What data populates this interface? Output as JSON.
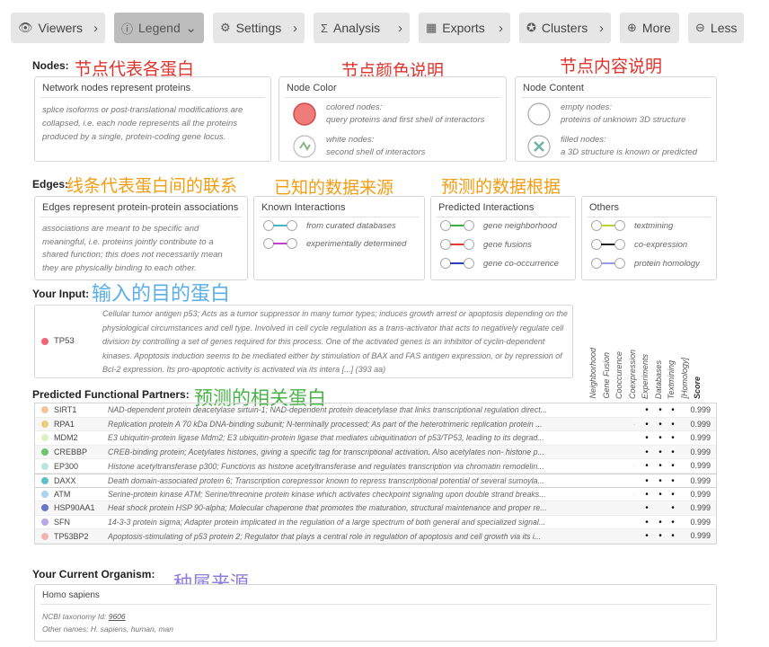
{
  "toolbar": {
    "buttons": [
      {
        "icon": "eye-icon",
        "glyph": "👁",
        "label": "Viewers",
        "chevron": "›"
      },
      {
        "icon": "info-icon",
        "glyph": "ⓘ",
        "label": "Legend",
        "chevron": "⌄"
      },
      {
        "icon": "gear-icon",
        "glyph": "⚙",
        "label": "Settings",
        "chevron": "›"
      },
      {
        "icon": "sigma-icon",
        "glyph": "Σ",
        "label": "Analysis",
        "chevron": "›"
      },
      {
        "icon": "table-icon",
        "glyph": "▦",
        "label": "Exports",
        "chevron": "›"
      },
      {
        "icon": "clusters-icon",
        "glyph": "✪",
        "label": "Clusters",
        "chevron": "›"
      },
      {
        "icon": "plus-circle-icon",
        "glyph": "⊕",
        "label": "More",
        "chevron": ""
      },
      {
        "icon": "minus-circle-icon",
        "glyph": "⊖",
        "label": "Less",
        "chevron": ""
      }
    ]
  },
  "nodes": {
    "label": "Nodes:",
    "annot_left": "节点代表各蛋白",
    "annot_mid": "节点颜色说明",
    "annot_right": "节点内容说明",
    "box1": {
      "title": "Network nodes represent proteins",
      "text": "splice isoforms or post-translational modifications are collapsed, i.e. each node represents all the proteins produced by a single, protein-coding gene locus."
    },
    "color_box": {
      "title": "Node Color",
      "colored": "colored nodes:\nquery proteins and first shell of interactors",
      "white": "white nodes:\nsecond shell of interactors"
    },
    "content_box": {
      "title": "Node Content",
      "empty": "empty nodes:\nproteins of unknown 3D structure",
      "filled": "filled nodes:\na 3D structure is known or predicted"
    }
  },
  "edges": {
    "label": "Edges:",
    "annot_left": "线条代表蛋白间的联系",
    "annot_mid": "已知的数据来源",
    "annot_right": "预测的数据根据",
    "box1": {
      "title": "Edges represent protein-protein associations",
      "text": "associations are meant to be specific and meaningful, i.e. proteins jointly contribute to a shared function; this does not necessarily mean they are physically binding to each other."
    },
    "known": {
      "title": "Known Interactions",
      "items": [
        {
          "label": "from curated databases",
          "color": "#3fb8c8"
        },
        {
          "label": "experimentally determined",
          "color": "#c040c8"
        }
      ]
    },
    "predicted": {
      "title": "Predicted Interactions",
      "items": [
        {
          "label": "gene neighborhood",
          "color": "#3cb043"
        },
        {
          "label": "gene fusions",
          "color": "#e23a2e"
        },
        {
          "label": "gene co-occurrence",
          "color": "#2f3dbf"
        }
      ]
    },
    "others": {
      "title": "Others",
      "items": [
        {
          "label": "textmining",
          "color": "#b5d334"
        },
        {
          "label": "co-expression",
          "color": "#222222"
        },
        {
          "label": "protein homology",
          "color": "#9a9ae8"
        }
      ]
    }
  },
  "input": {
    "label": "Your Input:",
    "annot": "输入的目的蛋白",
    "protein": "TP53",
    "dot_color": "#ee6677",
    "description": "Cellular tumor antigen p53; Acts as a tumor suppressor in many tumor types; induces growth arrest or apoptosis depending on the physiological circumstances and cell type. Involved in cell cycle regulation as a trans-activator that acts to negatively regulate cell division by controlling a set of genes required for this process. One of the activated genes is an inhibitor of cyclin-dependent kinases. Apoptosis induction seems to be mediated either by stimulation of BAX and FAS antigen expression, or by repression of Bcl-2 expression. Its pro-apoptotic activity is activated via its intera [...] (393 aa)"
  },
  "partners": {
    "label": "Predicted Functional Partners:",
    "annot": "预测的相关蛋白",
    "headers": [
      "Neighborhood",
      "Gene Fusion",
      "Cooccurence",
      "Coexpression",
      "Experiments",
      "Databases",
      "Textmining",
      "[Homology]",
      "Score"
    ],
    "rows": [
      {
        "name": "SIRT1",
        "color": "#f2c49b",
        "desc": "NAD-dependent protein deacetylase sirtuin-1; NAD-dependent protein deacetylase that links transcriptional regulation direct...",
        "ev": [
          "",
          "",
          "",
          "",
          "•",
          "•",
          "•",
          ""
        ],
        "score": "0.999"
      },
      {
        "name": "RPA1",
        "color": "#e8d07a",
        "desc": "Replication protein A 70 kDa DNA-binding subunit; N-terminally processed; As part of the heterotrimeric replication protein ...",
        "ev": [
          "",
          "",
          "",
          "·",
          "•",
          "•",
          "•",
          ""
        ],
        "score": "0.999"
      },
      {
        "name": "MDM2",
        "color": "#dbeec6",
        "desc": "E3 ubiquitin-protein ligase Mdm2; E3 ubiquitin-protein ligase that mediates ubiquitination of p53/TP53, leading to its degrad...",
        "ev": [
          "",
          "",
          "",
          "",
          "•",
          "•",
          "•",
          ""
        ],
        "score": "0.999"
      },
      {
        "name": "CREBBP",
        "color": "#6dc46d",
        "desc": "CREB-binding protein; Acetylates histones, giving a specific tag for transcriptional activation. Also acetylates non- histone p...",
        "ev": [
          "",
          "",
          "",
          "",
          "•",
          "•",
          "•",
          ""
        ],
        "score": "0.999"
      },
      {
        "name": "EP300",
        "color": "#b8e6df",
        "desc": "Histone acetyltransferase p300; Functions as histone acetyltransferase and regulates transcription via chromatin remodelin...",
        "ev": [
          "",
          "",
          "",
          "·",
          "•",
          "•",
          "•",
          ""
        ],
        "score": "0.999"
      },
      {
        "name": "DAXX",
        "color": "#5fc1c6",
        "desc": "Death domain-associated protein 6; Transcription corepressor known to repress transcriptional potential of several sumoyla...",
        "ev": [
          "",
          "",
          "",
          "",
          "•",
          "•",
          "•",
          ""
        ],
        "score": "0.999"
      },
      {
        "name": "ATM",
        "color": "#aad4ee",
        "desc": "Serine-protein kinase ATM; Serine/threonine protein kinase which activates checkpoint signaling upon double strand breaks...",
        "ev": [
          "",
          "",
          "",
          "·",
          "•",
          "•",
          "•",
          ""
        ],
        "score": "0.999"
      },
      {
        "name": "HSP90AA1",
        "color": "#6a76c8",
        "desc": "Heat shock protein HSP 90-alpha; Molecular chaperone that promotes the maturation, structural maintenance and proper re...",
        "ev": [
          "",
          "",
          "",
          "",
          "•",
          "",
          "•",
          ""
        ],
        "score": "0.999"
      },
      {
        "name": "SFN",
        "color": "#b9a8e8",
        "desc": "14-3-3 protein sigma; Adapter protein implicated in the regulation of a large spectrum of both general and specialized signal...",
        "ev": [
          "",
          "",
          "",
          "",
          "•",
          "•",
          "•",
          ""
        ],
        "score": "0.999"
      },
      {
        "name": "TP53BP2",
        "color": "#f2b3b3",
        "desc": "Apoptosis-stimulating of p53 protein 2; Regulator that plays a central role in regulation of apoptosis and cell growth via its i...",
        "ev": [
          "",
          "",
          "",
          "",
          "•",
          "•",
          "•",
          ""
        ],
        "score": "0.999"
      }
    ]
  },
  "organism": {
    "label": "Your Current Organism:",
    "annot": "种属来源",
    "name": "Homo sapiens",
    "taxonomy_prefix": "NCBI taxonomy Id:",
    "taxonomy_id": "9606",
    "other_names": "Other names: H. sapiens, human, man"
  }
}
